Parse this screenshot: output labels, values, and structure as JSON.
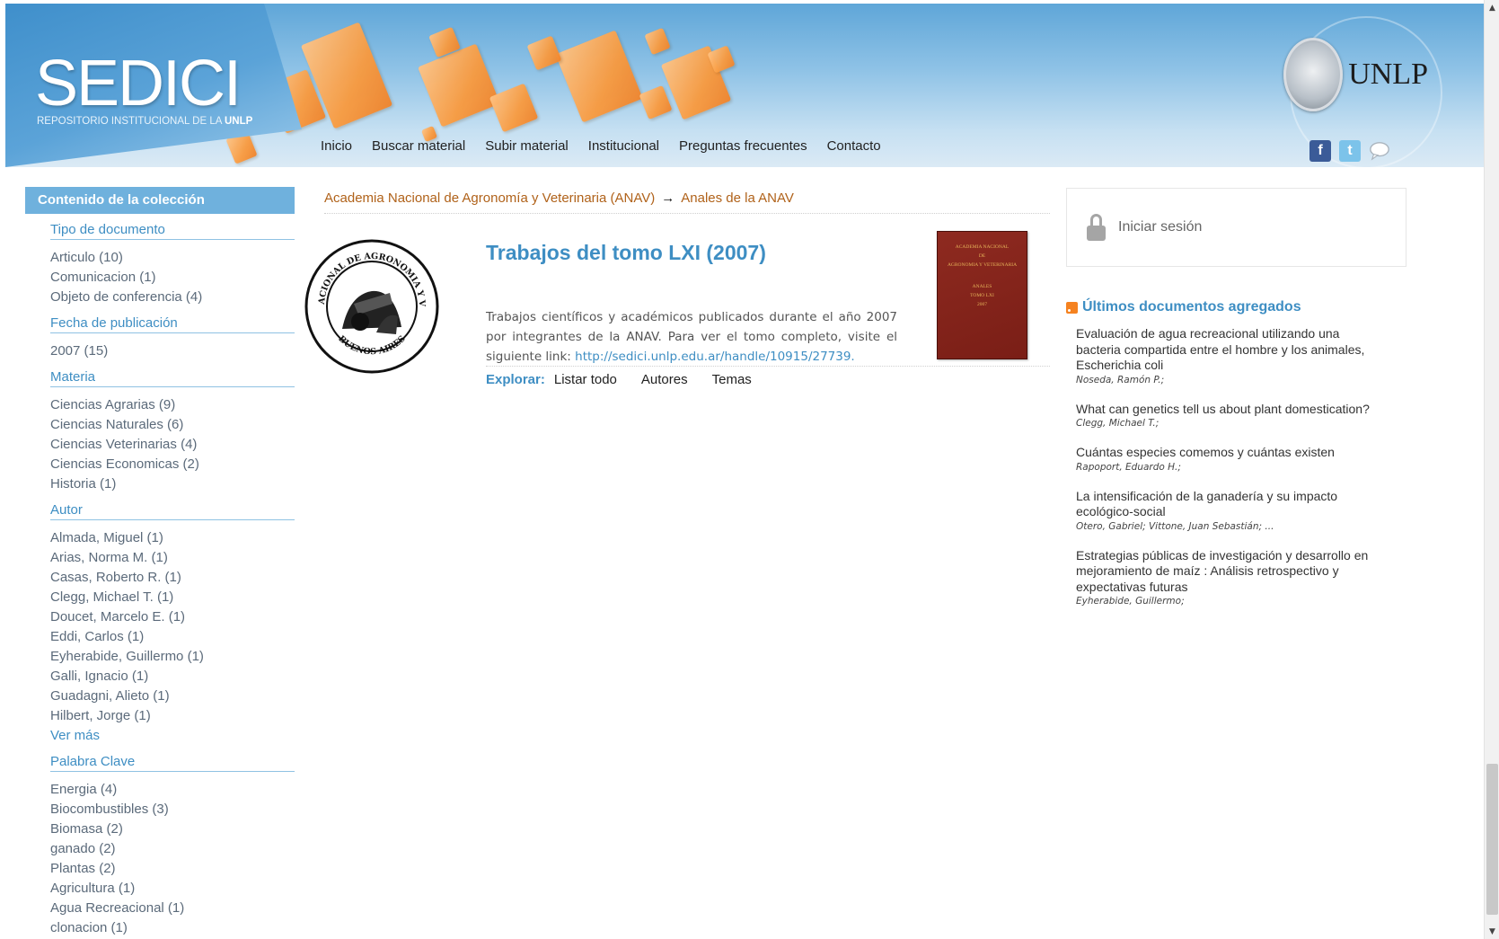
{
  "header": {
    "logo": "SEDICI",
    "subtitle_prefix": "REPOSITORIO INSTITUCIONAL DE LA",
    "subtitle_bold": "UNLP",
    "university": "UNLP",
    "social": {
      "facebook": "f",
      "twitter": "t"
    }
  },
  "nav": [
    "Inicio",
    "Buscar material",
    "Subir material",
    "Institucional",
    "Preguntas frecuentes",
    "Contacto"
  ],
  "sidebar": {
    "title": "Contenido de la colección",
    "facets": [
      {
        "heading": "Tipo de documento",
        "items": [
          "Articulo (10)",
          "Comunicacion (1)",
          "Objeto de conferencia (4)"
        ]
      },
      {
        "heading": "Fecha de publicación",
        "items": [
          "2007 (15)"
        ]
      },
      {
        "heading": "Materia",
        "items": [
          "Ciencias Agrarias (9)",
          "Ciencias Naturales (6)",
          "Ciencias Veterinarias (4)",
          "Ciencias Economicas (2)",
          "Historia (1)"
        ]
      },
      {
        "heading": "Autor",
        "items": [
          "Almada, Miguel (1)",
          "Arias, Norma M. (1)",
          "Casas, Roberto R. (1)",
          "Clegg, Michael T. (1)",
          "Doucet, Marcelo E. (1)",
          "Eddi, Carlos (1)",
          "Eyherabide, Guillermo (1)",
          "Galli, Ignacio (1)",
          "Guadagni, Alieto (1)",
          "Hilbert, Jorge (1)"
        ],
        "more": "Ver más"
      },
      {
        "heading": "Palabra Clave",
        "items": [
          "Energia (4)",
          "Biocombustibles (3)",
          "Biomasa (2)",
          "ganado (2)",
          "Plantas (2)",
          "Agricultura (1)",
          "Agua Recreacional (1)",
          "clonacion (1)"
        ]
      }
    ]
  },
  "breadcrumb": {
    "parent": "Academia Nacional de Agronomía y Veterinaria (ANAV)",
    "arrow": "→",
    "current": "Anales de la ANAV"
  },
  "collection": {
    "title": "Trabajos del tomo LXI (2007)",
    "description": "Trabajos científicos y académicos publicados durante el año 2007 por integrantes de la ANAV. Para ver el tomo completo, visite el siguiente link:",
    "link": "http://sedici.unlp.edu.ar/handle/10915/27739.",
    "seal_text_top": "ACADEMIA NACIONAL DE AGRONOMIA Y VETERINARIA",
    "seal_text_bottom": "BUENOS AIRES",
    "cover_lines": [
      "ACADEMIA NACIONAL",
      "DE",
      "AGRONOMIA Y VETERINARIA",
      "ANALES",
      "TOMO LXI",
      "2007"
    ]
  },
  "explore": {
    "label": "Explorar:",
    "links": [
      "Listar todo",
      "Autores",
      "Temas"
    ]
  },
  "login": {
    "label": "Iniciar sesión"
  },
  "recent": {
    "heading": "Últimos documentos agregados",
    "items": [
      {
        "title": "Evaluación de agua recreacional utilizando una bacteria compartida entre el hombre y los animales, Escherichia coli",
        "authors": "Noseda, Ramón P.;"
      },
      {
        "title": "What can genetics tell us about plant domestication?",
        "authors": "Clegg, Michael T.;"
      },
      {
        "title": "Cuántas especies comemos y cuántas existen",
        "authors": "Rapoport, Eduardo H.;"
      },
      {
        "title": "La intensificación de la ganadería y su impacto ecológico-social",
        "authors": "Otero, Gabriel; Vittone, Juan Sebastián; ..."
      },
      {
        "title": "Estrategias públicas de investigación y desarrollo en mejoramiento de maíz : Análisis retrospectivo y expectativas futuras",
        "authors": "Eyherabide, Guillermo;"
      }
    ]
  },
  "scrollbar": {
    "position_fraction": 0.85
  },
  "colors": {
    "accent": "#3e8ec3",
    "breadcrumb": "#b0621a",
    "header_blue": "#5fa6d8",
    "deco_orange": "#f99a3e"
  }
}
